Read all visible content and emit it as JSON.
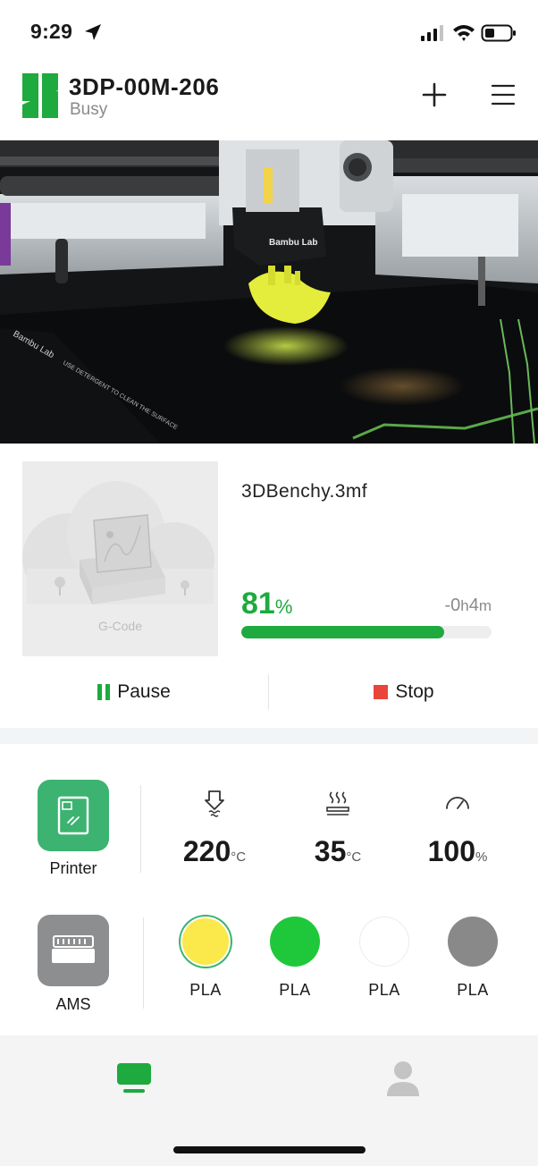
{
  "status_bar": {
    "time": "9:29"
  },
  "header": {
    "printer_name": "3DP-00M-206",
    "status": "Busy"
  },
  "camera": {
    "brand_on_toolhead": "Bambu Lab"
  },
  "job": {
    "file_name": "3DBenchy.3mf",
    "thumbnail_label": "G-Code",
    "progress_value": "81",
    "progress_unit": "%",
    "progress_fraction": 0.81,
    "remaining_prefix": "-0",
    "remaining_h": "h",
    "remaining_minutes": "4",
    "remaining_m": "m",
    "pause_label": "Pause",
    "stop_label": "Stop"
  },
  "printer_panel": {
    "label": "Printer",
    "nozzle_temp": "220",
    "nozzle_unit": "°C",
    "bed_temp": "35",
    "bed_unit": "°C",
    "speed": "100",
    "speed_unit": "%"
  },
  "ams_panel": {
    "label": "AMS",
    "slots": [
      {
        "type": "PLA",
        "color": "#fbe84a",
        "selected": true
      },
      {
        "type": "PLA",
        "color": "#1ec83a",
        "selected": false
      },
      {
        "type": "PLA",
        "color": "#ffffff",
        "selected": false
      },
      {
        "type": "PLA",
        "color": "#898989",
        "selected": false
      }
    ]
  },
  "colors": {
    "accent": "#1eaa3e",
    "stop": "#e8463a",
    "printer_tile": "#3cb370",
    "ams_tile": "#8c8e90"
  },
  "icons": [
    "location-arrow-icon",
    "signal-icon",
    "wifi-icon",
    "battery-icon",
    "bambu-logo-icon",
    "plus-icon",
    "menu-icon",
    "nozzle-icon",
    "heatbed-icon",
    "speed-gauge-icon",
    "devices-icon",
    "user-icon"
  ]
}
